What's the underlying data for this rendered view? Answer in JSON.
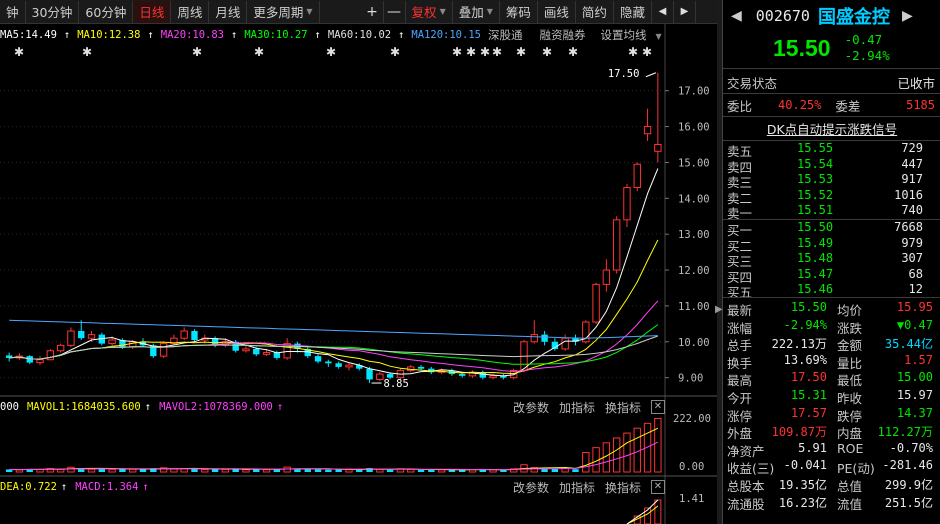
{
  "toolbar": {
    "items": [
      {
        "label": "钟",
        "active": false
      },
      {
        "label": "30分钟",
        "active": false
      },
      {
        "label": "60分钟",
        "active": false
      },
      {
        "label": "日线",
        "active": true
      },
      {
        "label": "周线",
        "active": false
      },
      {
        "label": "月线",
        "active": false
      },
      {
        "label": "更多周期",
        "active": false
      }
    ],
    "plus": "+",
    "minus": "—",
    "fuquan": "复权",
    "diejia": "叠加",
    "chouma": "筹码",
    "huaxian": "画线",
    "jianyue": "简约",
    "yincang": "隐藏",
    "nav_left": "◀",
    "nav_right": "▶"
  },
  "ma_line": {
    "ma5": "MA5:14.49",
    "ma10": "MA10:12.38",
    "ma20": "MA20:10.83",
    "ma30": "MA30:10.27",
    "ma60": "MA60:10.02",
    "ma120": "MA120:10.15",
    "shengutong": "深股通",
    "rongzi": "融资融券",
    "shezhi": "设置均线"
  },
  "volume_panel": {
    "vol": "000",
    "mavol1": "MAVOL1:1684035.600",
    "mavol2": "MAVOL2:1078369.000",
    "gai": "改参数",
    "jia": "加指标",
    "huan": "换指标",
    "close": "✕",
    "axis_top": "222.00",
    "axis_bottom": "0.00"
  },
  "macd_panel": {
    "dea": "DEA:0.722",
    "macd": "MACD:1.364",
    "gai": "改参数",
    "jia": "加指标",
    "huan": "换指标",
    "close": "✕",
    "axis_top": "1.41"
  },
  "chart_data": {
    "type": "candlestick",
    "y_ticks": [
      "17.00",
      "16.00",
      "15.00",
      "14.00",
      "13.00",
      "12.00",
      "11.00",
      "10.00",
      "9.00"
    ],
    "ylim": [
      8.6,
      17.8
    ],
    "annotations": {
      "high": "17.50",
      "low": "8.85"
    },
    "candles": [
      [
        9.62,
        9.55,
        9.7,
        9.45
      ],
      [
        9.55,
        9.6,
        9.68,
        9.5
      ],
      [
        9.6,
        9.42,
        9.63,
        9.38
      ],
      [
        9.42,
        9.5,
        9.6,
        9.35
      ],
      [
        9.5,
        9.75,
        9.8,
        9.48
      ],
      [
        9.75,
        9.9,
        9.95,
        9.7
      ],
      [
        9.9,
        10.3,
        10.4,
        9.85
      ],
      [
        10.3,
        10.1,
        10.6,
        10.05
      ],
      [
        10.1,
        10.2,
        10.3,
        10.0
      ],
      [
        10.2,
        9.95,
        10.25,
        9.9
      ],
      [
        9.95,
        10.05,
        10.15,
        9.9
      ],
      [
        10.05,
        9.85,
        10.1,
        9.8
      ],
      [
        9.85,
        10.0,
        10.05,
        9.8
      ],
      [
        10.0,
        9.9,
        10.1,
        9.85
      ],
      [
        9.9,
        9.6,
        9.95,
        9.55
      ],
      [
        9.6,
        9.95,
        10.0,
        9.55
      ],
      [
        9.95,
        10.1,
        10.2,
        9.9
      ],
      [
        10.1,
        10.3,
        10.4,
        10.05
      ],
      [
        10.3,
        10.05,
        10.35,
        10.0
      ],
      [
        10.05,
        10.1,
        10.2,
        9.95
      ],
      [
        10.1,
        9.9,
        10.15,
        9.85
      ],
      [
        9.9,
        10.0,
        10.1,
        9.85
      ],
      [
        10.0,
        9.75,
        10.05,
        9.7
      ],
      [
        9.75,
        9.8,
        9.9,
        9.7
      ],
      [
        9.8,
        9.65,
        9.85,
        9.6
      ],
      [
        9.65,
        9.7,
        9.8,
        9.6
      ],
      [
        9.7,
        9.55,
        9.75,
        9.5
      ],
      [
        9.55,
        9.95,
        10.1,
        9.5
      ],
      [
        9.95,
        9.8,
        10.0,
        9.7
      ],
      [
        9.8,
        9.6,
        9.85,
        9.55
      ],
      [
        9.6,
        9.45,
        9.65,
        9.4
      ],
      [
        9.45,
        9.4,
        9.5,
        9.3
      ],
      [
        9.4,
        9.3,
        9.45,
        9.25
      ],
      [
        9.3,
        9.35,
        9.4,
        9.2
      ],
      [
        9.35,
        9.25,
        9.4,
        9.2
      ],
      [
        9.25,
        8.95,
        9.3,
        8.85
      ],
      [
        8.95,
        9.1,
        9.15,
        8.9
      ],
      [
        9.1,
        9.0,
        9.15,
        8.95
      ],
      [
        9.0,
        9.2,
        9.25,
        8.95
      ],
      [
        9.2,
        9.3,
        9.35,
        9.15
      ],
      [
        9.3,
        9.25,
        9.35,
        9.2
      ],
      [
        9.25,
        9.15,
        9.3,
        9.1
      ],
      [
        9.15,
        9.2,
        9.25,
        9.1
      ],
      [
        9.2,
        9.1,
        9.25,
        9.05
      ],
      [
        9.1,
        9.05,
        9.15,
        9.0
      ],
      [
        9.05,
        9.15,
        9.2,
        9.0
      ],
      [
        9.15,
        9.0,
        9.2,
        8.95
      ],
      [
        9.0,
        9.05,
        9.1,
        8.95
      ],
      [
        9.05,
        9.0,
        9.1,
        8.95
      ],
      [
        9.0,
        9.2,
        9.25,
        8.95
      ],
      [
        9.2,
        10.0,
        10.05,
        9.15
      ],
      [
        10.0,
        10.2,
        10.6,
        9.95
      ],
      [
        10.2,
        10.0,
        10.3,
        9.9
      ],
      [
        10.0,
        9.8,
        10.1,
        9.75
      ],
      [
        9.8,
        10.1,
        10.2,
        9.75
      ],
      [
        10.1,
        10.0,
        10.2,
        9.9
      ],
      [
        10.0,
        10.55,
        10.6,
        9.95
      ],
      [
        10.55,
        11.6,
        11.65,
        10.5
      ],
      [
        11.6,
        12.0,
        12.3,
        11.4
      ],
      [
        12.0,
        13.4,
        13.5,
        11.9
      ],
      [
        13.4,
        14.3,
        14.4,
        13.2
      ],
      [
        14.3,
        14.95,
        15.0,
        14.2
      ],
      [
        15.8,
        16.0,
        16.5,
        15.6
      ],
      [
        15.31,
        15.5,
        17.5,
        15.0
      ]
    ]
  },
  "side": {
    "code": "002670",
    "name": "国盛金控",
    "price": "15.50",
    "change": "-0.47",
    "pct": "-2.94%",
    "trade_status_label": "交易状态",
    "trade_status": "已收市",
    "weibi_label": "委比",
    "weibi": "40.25%",
    "weicha_label": "委差",
    "weicha": "5185",
    "dk_text": "DK点自动提示涨跌信号",
    "asks": [
      {
        "name": "卖五",
        "price": "15.55",
        "vol": "729"
      },
      {
        "name": "卖四",
        "price": "15.54",
        "vol": "447"
      },
      {
        "name": "卖三",
        "price": "15.53",
        "vol": "917"
      },
      {
        "name": "卖二",
        "price": "15.52",
        "vol": "1016"
      },
      {
        "name": "卖一",
        "price": "15.51",
        "vol": "740"
      }
    ],
    "bids": [
      {
        "name": "买一",
        "price": "15.50",
        "vol": "7668"
      },
      {
        "name": "买二",
        "price": "15.49",
        "vol": "979"
      },
      {
        "name": "买三",
        "price": "15.48",
        "vol": "307"
      },
      {
        "name": "买四",
        "price": "15.47",
        "vol": "68"
      },
      {
        "name": "买五",
        "price": "15.46",
        "vol": "12"
      }
    ],
    "quotes": [
      {
        "l1": "最新",
        "v1": "15.50",
        "c1": "green",
        "l2": "均价",
        "v2": "15.95",
        "c2": "red"
      },
      {
        "l1": "涨幅",
        "v1": "-2.94%",
        "c1": "green",
        "l2": "涨跌",
        "v2": "▼0.47",
        "c2": "green"
      },
      {
        "l1": "总手",
        "v1": "222.13万",
        "c1": "white",
        "l2": "金额",
        "v2": "35.44亿",
        "c2": "cyan"
      },
      {
        "l1": "换手",
        "v1": "13.69%",
        "c1": "white",
        "l2": "量比",
        "v2": "1.57",
        "c2": "red"
      },
      {
        "l1": "最高",
        "v1": "17.50",
        "c1": "red",
        "l2": "最低",
        "v2": "15.00",
        "c2": "green"
      },
      {
        "l1": "今开",
        "v1": "15.31",
        "c1": "green",
        "l2": "昨收",
        "v2": "15.97",
        "c2": "white"
      },
      {
        "l1": "涨停",
        "v1": "17.57",
        "c1": "red",
        "l2": "跌停",
        "v2": "14.37",
        "c2": "green"
      },
      {
        "l1": "外盘",
        "v1": "109.87万",
        "c1": "red",
        "l2": "内盘",
        "v2": "112.27万",
        "c2": "green"
      },
      {
        "l1": "净资产",
        "v1": "5.91",
        "c1": "white",
        "l2": "ROE",
        "v2": "-0.70%",
        "c2": "white"
      },
      {
        "l1": "收益(三)",
        "v1": "-0.041",
        "c1": "white",
        "l2": "PE(动)",
        "v2": "-281.46",
        "c2": "white"
      },
      {
        "l1": "总股本",
        "v1": "19.35亿",
        "c1": "white",
        "l2": "总值",
        "v2": "299.9亿",
        "c2": "white"
      },
      {
        "l1": "流通股",
        "v1": "16.23亿",
        "c1": "white",
        "l2": "流值",
        "v2": "251.5亿",
        "c2": "white"
      }
    ]
  }
}
